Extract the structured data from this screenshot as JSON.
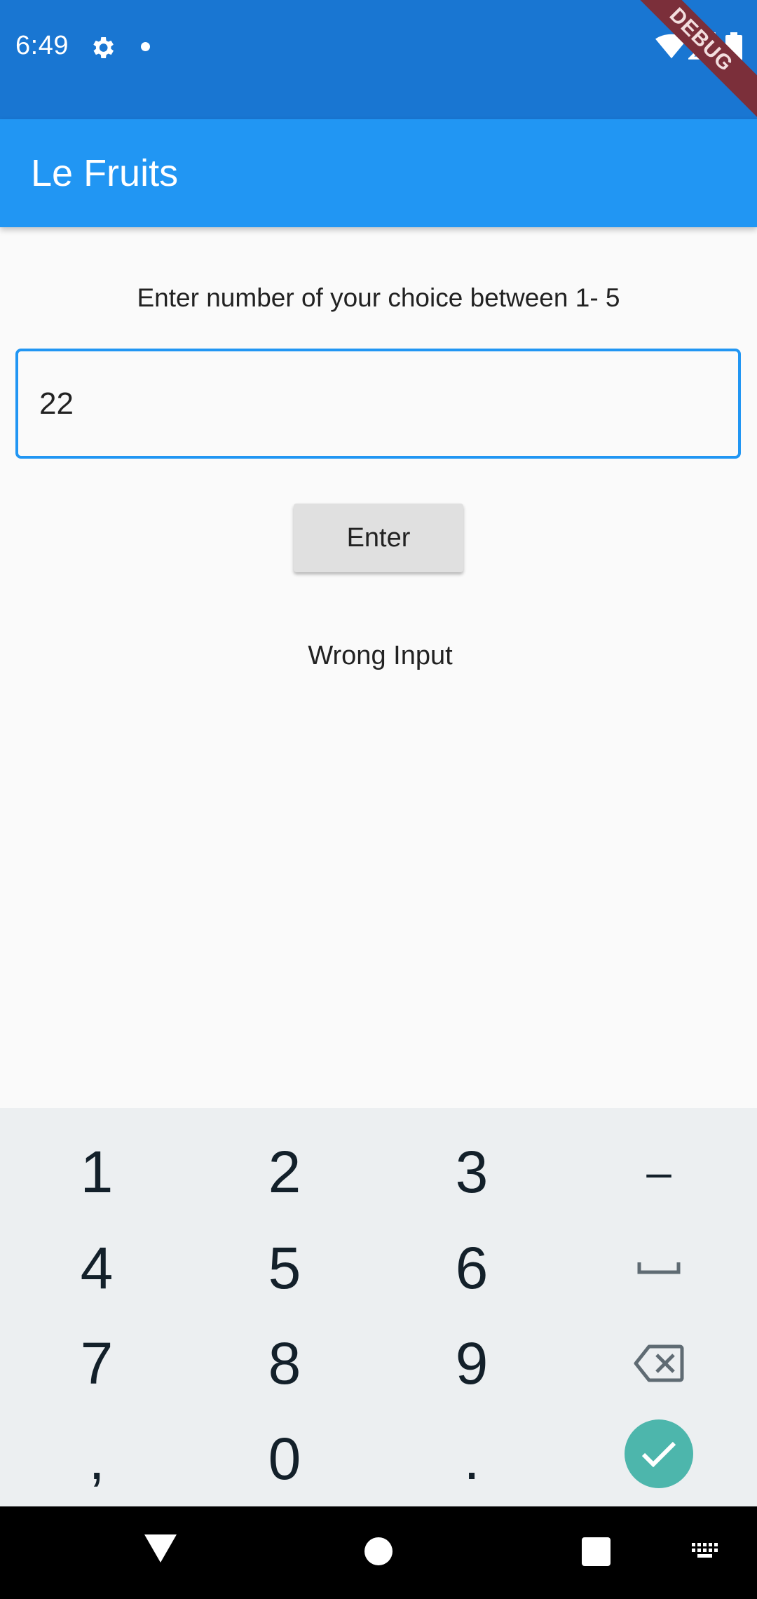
{
  "status_bar": {
    "time": "6:49",
    "icons": [
      "gear-icon",
      "notification-dot-icon",
      "wifi-icon",
      "signal-icon",
      "battery-icon"
    ],
    "debug_banner": "DEBUG",
    "bg_color": "#1976d2"
  },
  "app_bar": {
    "title": "Le Fruits",
    "bg_color": "#2196f3"
  },
  "main": {
    "prompt": "Enter number of your choice between 1- 5",
    "number_input": {
      "value": "22",
      "placeholder": ""
    },
    "enter_button": "Enter",
    "result": "Wrong Input"
  },
  "keyboard": {
    "rows": [
      [
        "1",
        "2",
        "3",
        "–"
      ],
      [
        "4",
        "5",
        "6",
        "space-icon"
      ],
      [
        "7",
        "8",
        "9",
        "backspace-icon"
      ],
      [
        ",",
        "0",
        ".",
        "done-check-icon"
      ]
    ],
    "done_color": "#4db6ac"
  },
  "nav_bar": {
    "buttons": [
      "back-icon",
      "home-icon",
      "recents-icon",
      "keyboard-switch-icon"
    ]
  }
}
